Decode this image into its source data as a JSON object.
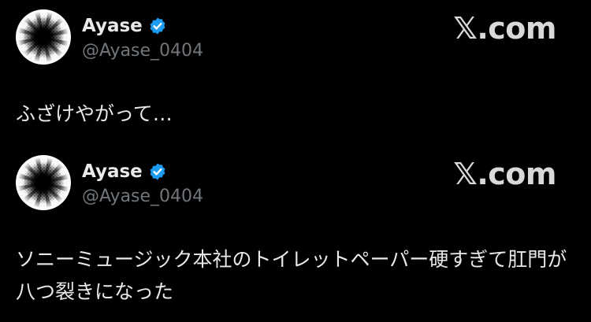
{
  "colors": {
    "background": "#000000",
    "text": "#e7e9ea",
    "secondary": "#71767b",
    "verified": "#1d9bf0"
  },
  "posts": [
    {
      "author": {
        "display_name": "Ayase",
        "handle": "@Ayase_0404",
        "verified": true,
        "avatar_icon": "halftone-avatar-icon"
      },
      "brand": "𝕏.com",
      "text": "ふざけやがって…"
    },
    {
      "author": {
        "display_name": "Ayase",
        "handle": "@Ayase_0404",
        "verified": true,
        "avatar_icon": "halftone-avatar-icon"
      },
      "brand": "𝕏.com",
      "text": "ソニーミュージック本社のトイレットペーパー硬すぎて肛門が八つ裂きになった"
    }
  ]
}
